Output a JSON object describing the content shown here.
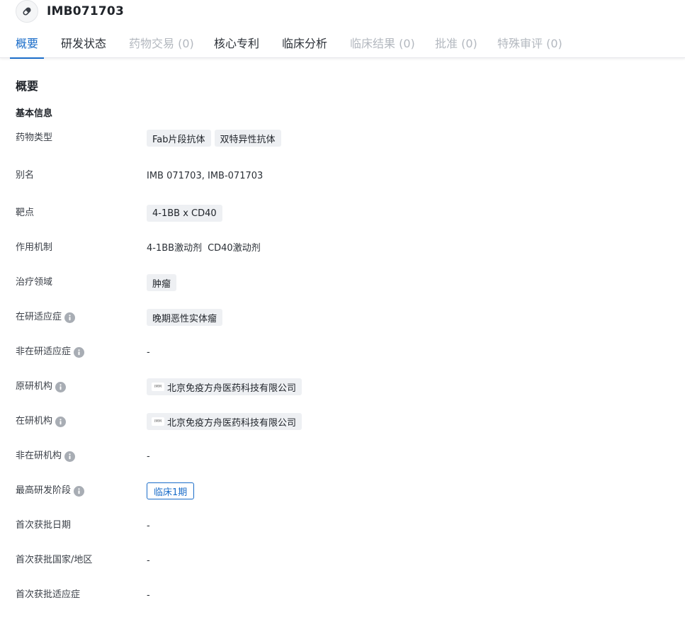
{
  "header": {
    "title": "IMB071703",
    "icon": "pill-icon"
  },
  "tabs": [
    {
      "label": "概要",
      "state": "active"
    },
    {
      "label": "研发状态",
      "state": "normal"
    },
    {
      "label": "药物交易 (0)",
      "state": "disabled"
    },
    {
      "label": "核心专利",
      "state": "normal"
    },
    {
      "label": "临床分析",
      "state": "normal"
    },
    {
      "label": "临床结果 (0)",
      "state": "disabled"
    },
    {
      "label": "批准 (0)",
      "state": "disabled"
    },
    {
      "label": "特殊审评 (0)",
      "state": "disabled"
    }
  ],
  "section": {
    "title": "概要",
    "subtitle": "基本信息"
  },
  "fields": {
    "drug_type": {
      "label": "药物类型",
      "tags": [
        "Fab片段抗体",
        "双特异性抗体"
      ]
    },
    "aliases": {
      "label": "别名",
      "value": "IMB 071703,  IMB-071703"
    },
    "target": {
      "label": "靶点",
      "tags": [
        "4-1BB x CD40"
      ]
    },
    "mechanism": {
      "label": "作用机制",
      "items": [
        "4-1BB激动剂",
        "CD40激动剂"
      ]
    },
    "therapeutic_area": {
      "label": "治疗领域",
      "tags": [
        "肿瘤"
      ]
    },
    "active_indication": {
      "label": "在研适应症",
      "tags": [
        "晚期恶性实体瘤"
      ]
    },
    "inactive_indication": {
      "label": "非在研适应症",
      "value": "-"
    },
    "originator": {
      "label": "原研机构",
      "org": "北京免疫方舟医药科技有限公司",
      "logo_text": "IMM"
    },
    "active_org": {
      "label": "在研机构",
      "org": "北京免疫方舟医药科技有限公司",
      "logo_text": "IMM"
    },
    "inactive_org": {
      "label": "非在研机构",
      "value": "-"
    },
    "highest_phase": {
      "label": "最高研发阶段",
      "value": "临床1期"
    },
    "first_approval_date": {
      "label": "首次获批日期",
      "value": "-"
    },
    "first_approval_country": {
      "label": "首次获批国家/地区",
      "value": "-"
    },
    "first_approval_indication": {
      "label": "首次获批适应症",
      "value": "-"
    }
  },
  "colors": {
    "accent": "#1b6dc9",
    "disabled_tab": "#b3b8bf",
    "tag_bg": "#eef0f3",
    "info_icon": "#a8adb4"
  }
}
